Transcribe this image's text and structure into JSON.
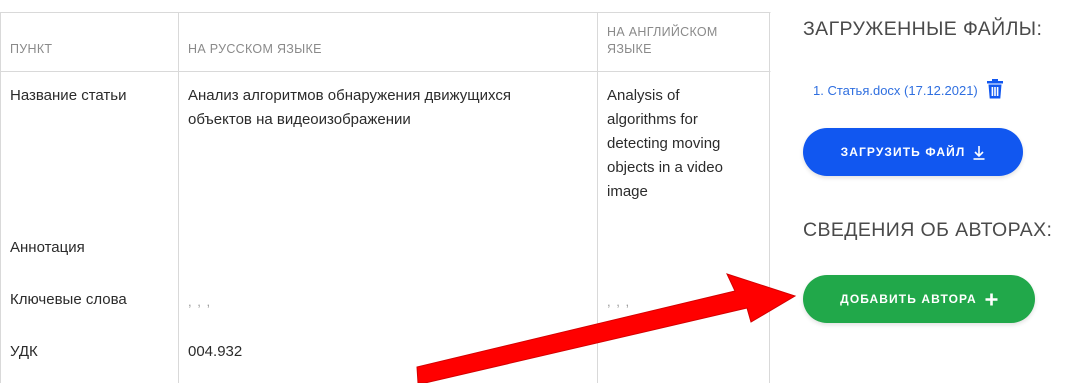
{
  "table": {
    "headers": {
      "item": "ПУНКТ",
      "russian": "НА РУССКОМ ЯЗЫКЕ",
      "english_line1": "НА АНГЛИЙСКОМ",
      "english_line2": "ЯЗЫКЕ"
    },
    "rows": [
      {
        "label": "Название статьи",
        "ru_lines": [
          "Анализ алгоритмов обнаружения движущихся",
          "объектов на видеоизображении"
        ],
        "en_lines": [
          "Analysis of",
          "algorithms for",
          "detecting moving",
          "objects in a video",
          "image"
        ]
      },
      {
        "label": "Аннотация",
        "ru": "",
        "en": ""
      },
      {
        "label": "Ключевые слова",
        "ru": ", , ,",
        "en": ", , ,"
      },
      {
        "label": "УДК",
        "ru": "004.932",
        "en": ""
      }
    ]
  },
  "files": {
    "title": "ЗАГРУЖЕННЫЕ ФАЙЛЫ:",
    "items": [
      {
        "label": "1. Статья.docx (17.12.2021)",
        "icon": "trash-icon"
      }
    ],
    "upload_button": "ЗАГРУЗИТЬ ФАЙЛ",
    "upload_icon": "download-icon"
  },
  "authors": {
    "title": "СВЕДЕНИЯ ОБ АВТОРАХ:",
    "add_button": "ДОБАВИТЬ АВТОРА",
    "add_icon": "plus-icon"
  },
  "colors": {
    "upload_button": "#1157f0",
    "add_button": "#21a84a",
    "link": "#2f6fe0",
    "arrow": "#ff0000"
  }
}
